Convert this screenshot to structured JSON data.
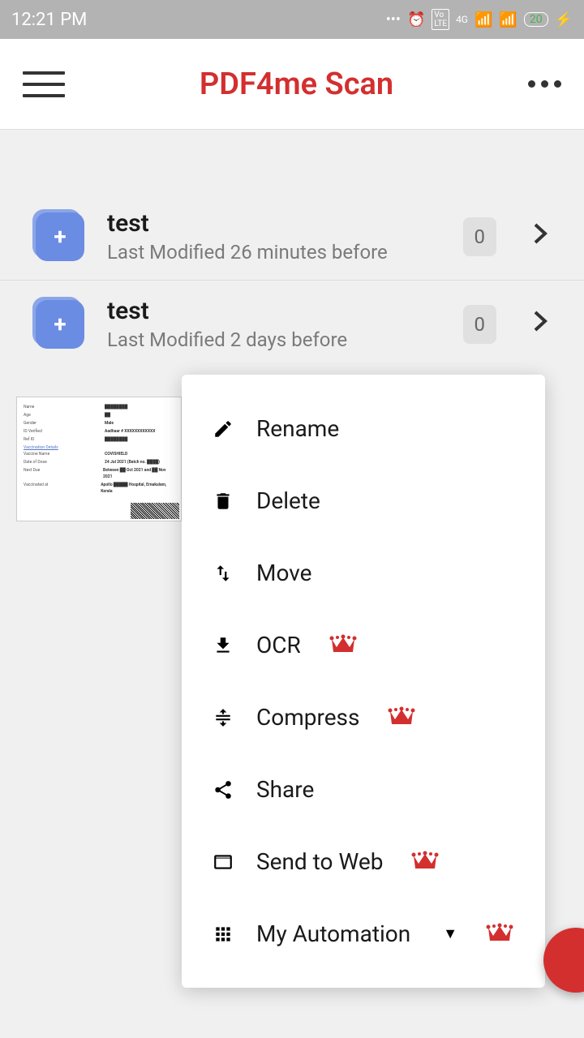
{
  "status": {
    "time": "12:21 PM",
    "network": "4G",
    "battery": "20"
  },
  "header": {
    "title": "PDF4me Scan"
  },
  "folders": [
    {
      "title": "test",
      "subtitle": "Last Modified 26 minutes before",
      "count": "0"
    },
    {
      "title": "test",
      "subtitle": "Last Modified 2 days before",
      "count": "0"
    }
  ],
  "menu": {
    "rename": "Rename",
    "delete": "Delete",
    "move": "Move",
    "ocr": "OCR",
    "compress": "Compress",
    "share": "Share",
    "sendToWeb": "Send to Web",
    "automation": "My Automation"
  }
}
